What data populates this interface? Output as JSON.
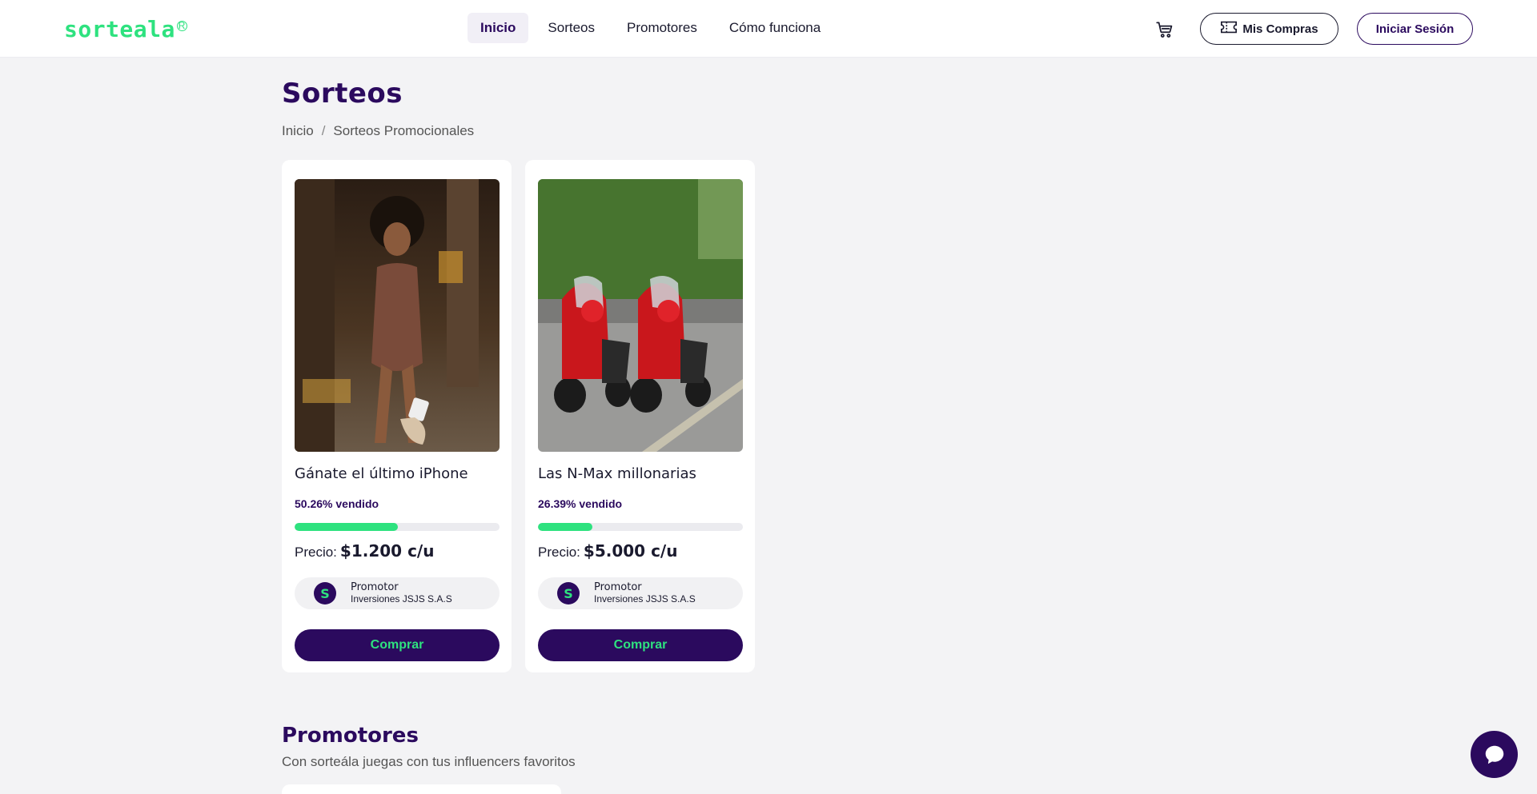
{
  "brand": {
    "logo_text": "sorteala",
    "logo_mark": "R",
    "primary_color": "#2b0a5e",
    "accent_color": "#2ee27f"
  },
  "nav": {
    "links": [
      {
        "label": "Inicio",
        "active": true
      },
      {
        "label": "Sorteos",
        "active": false
      },
      {
        "label": "Promotores",
        "active": false
      },
      {
        "label": "Cómo funciona",
        "active": false
      }
    ],
    "cart_icon": "shopping-cart-icon",
    "mis_compras": "Mis Compras",
    "iniciar_sesion": "Iniciar Sesión"
  },
  "page": {
    "title": "Sorteos",
    "breadcrumb": [
      "Inicio",
      "/",
      "Sorteos Promocionales"
    ]
  },
  "raffles": [
    {
      "title": "Gánate el último iPhone",
      "sold_text": "50.26% vendido",
      "sold_fraction": 0.5026,
      "price_label": "Precio:",
      "price_value": "$1.200 c/u",
      "promoter_label": "Promotor",
      "promoter_name": "Inversiones JSJS S.A.S",
      "buy_label": "Comprar"
    },
    {
      "title": "Las N-Max millonarias",
      "sold_text": "26.39% vendido",
      "sold_fraction": 0.2639,
      "price_label": "Precio:",
      "price_value": "$5.000 c/u",
      "promoter_label": "Promotor",
      "promoter_name": "Inversiones JSJS S.A.S",
      "buy_label": "Comprar"
    }
  ],
  "promoters_section": {
    "title": "Promotores",
    "subtitle": "Con sorteála juegas con tus influencers favoritos"
  },
  "chat_icon": "chat-bubble-icon"
}
